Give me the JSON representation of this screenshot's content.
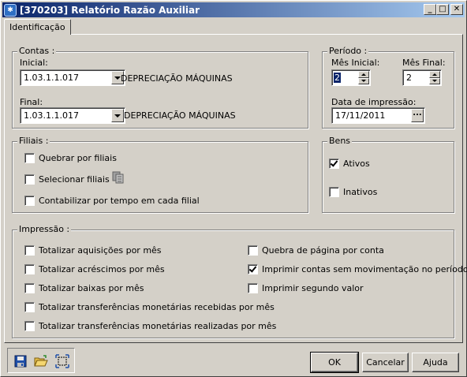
{
  "window": {
    "title": "[370203]  Relatório Razão Auxiliar",
    "controls": [
      "_",
      "□",
      "✕"
    ]
  },
  "tabs": [
    {
      "label": "Identificação",
      "active": true
    }
  ],
  "contas": {
    "legend": "Contas :",
    "inicial_label": "Inicial:",
    "inicial_value": "1.03.1.1.017",
    "inicial_desc": "DEPRECIAÇÃO MÁQUINAS",
    "final_label": "Final:",
    "final_value": "1.03.1.1.017",
    "final_desc": "DEPRECIAÇÃO MÁQUINAS"
  },
  "periodo": {
    "legend": "Período :",
    "mes_inicial_label": "Mês Inicial:",
    "mes_inicial_value": "2",
    "mes_final_label": "Mês Final:",
    "mes_final_value": "2",
    "data_impressao_label": "Data de impressão:",
    "data_impressao_value": "17/11/2011",
    "picker_label": "..."
  },
  "filiais": {
    "legend": "Filiais :",
    "options": [
      {
        "label": "Quebrar por filiais",
        "checked": false
      },
      {
        "label": "Selecionar filiais",
        "checked": false
      },
      {
        "label": "Contabilizar por tempo em cada filial",
        "checked": false
      }
    ]
  },
  "bens": {
    "legend": "Bens",
    "options": [
      {
        "label": "Ativos",
        "checked": true
      },
      {
        "label": "Inativos",
        "checked": false
      }
    ]
  },
  "impressao": {
    "legend": "Impressão :",
    "left_options": [
      {
        "label": "Totalizar aquisições por mês",
        "checked": false
      },
      {
        "label": "Totalizar acréscimos por mês",
        "checked": false
      },
      {
        "label": "Totalizar baixas por mês",
        "checked": false
      },
      {
        "label": "Totalizar transferências monetárias recebidas por mês",
        "checked": false
      },
      {
        "label": "Totalizar transferências monetárias realizadas por mês",
        "checked": false
      }
    ],
    "right_options": [
      {
        "label": "Quebra de página por conta",
        "checked": false
      },
      {
        "label": "Imprimir contas sem movimentação no período",
        "checked": true
      },
      {
        "label": "Imprimir segundo valor",
        "checked": false
      }
    ]
  },
  "buttons": {
    "ok": "OK",
    "cancelar": "Cancelar",
    "ajuda": "Ajuda"
  },
  "toolbar_icons": [
    "save-icon",
    "open-folder-icon",
    "resize-icon"
  ],
  "colors": {
    "face": "#d4d0c8",
    "title_start": "#0a246a",
    "title_end": "#a6caf0",
    "selection": "#0a246a"
  }
}
